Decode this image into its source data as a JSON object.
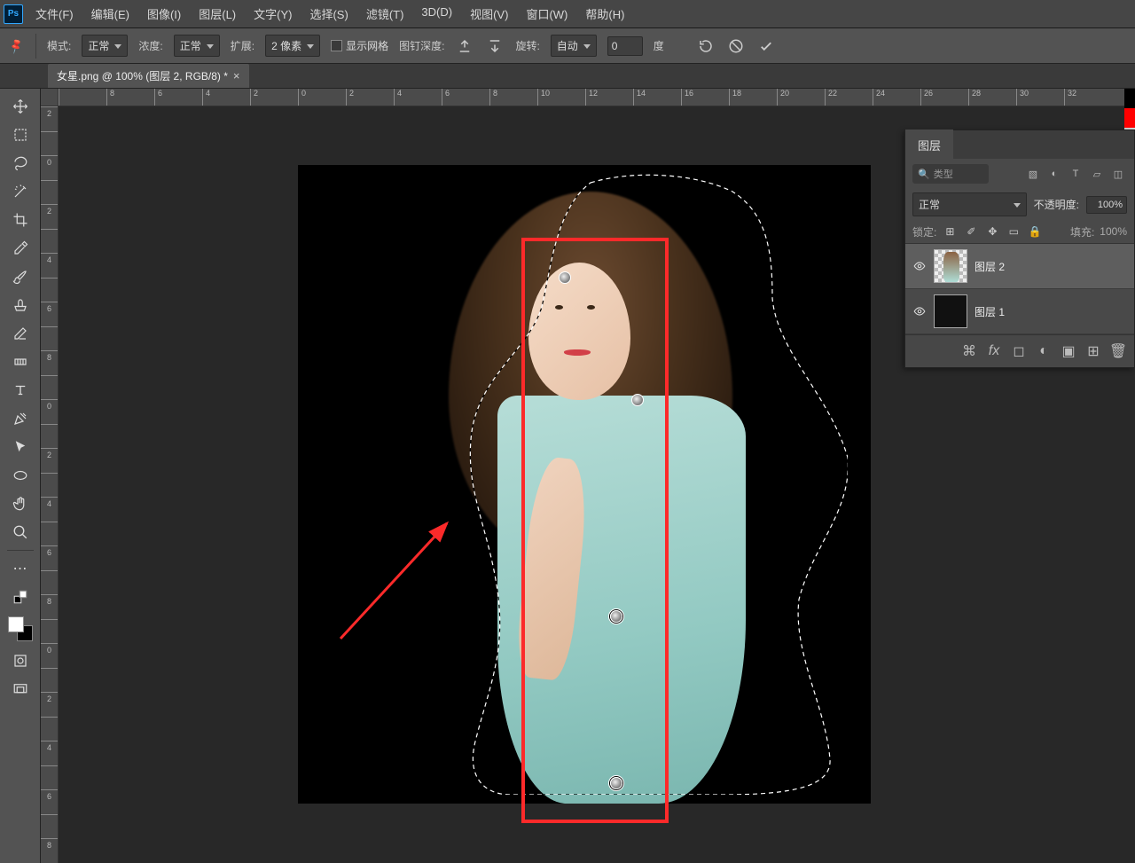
{
  "menu": {
    "items": [
      "文件(F)",
      "编辑(E)",
      "图像(I)",
      "图层(L)",
      "文字(Y)",
      "选择(S)",
      "滤镜(T)",
      "3D(D)",
      "视图(V)",
      "窗口(W)",
      "帮助(H)"
    ]
  },
  "options": {
    "mode_label": "模式:",
    "mode_value": "正常",
    "density_label": "浓度:",
    "density_value": "正常",
    "expand_label": "扩展:",
    "expand_value": "2 像素",
    "show_grid": "显示网格",
    "pin_depth_label": "图钉深度:",
    "rotate_label": "旋转:",
    "rotate_mode": "自动",
    "rotate_value": "0",
    "deg": "度"
  },
  "tab": {
    "title": "女星.png @ 100% (图层 2, RGB/8) *"
  },
  "ruler": {
    "h": [
      "",
      "8",
      "6",
      "4",
      "2",
      "0",
      "2",
      "4",
      "6",
      "8",
      "10",
      "12",
      "14",
      "16",
      "18",
      "20",
      "22",
      "24",
      "26",
      "28",
      "30",
      "32"
    ],
    "v": [
      "2",
      "",
      "0",
      "",
      "2",
      "",
      "4",
      "",
      "6",
      "",
      "8",
      "",
      "0",
      "",
      "2",
      "",
      "4",
      "",
      "6",
      "",
      "8",
      "",
      "0",
      "",
      "2",
      "",
      "4",
      "",
      "6",
      "",
      "8"
    ]
  },
  "panel": {
    "tab": "图层",
    "kind_placeholder": "类型",
    "blend": "正常",
    "opacity_label": "不透明度:",
    "opacity": "100%",
    "lock_label": "锁定:",
    "fill_label": "填充:",
    "fill": "100%",
    "layers": [
      {
        "name": "图层 2",
        "active": true,
        "trans": true
      },
      {
        "name": "图层 1",
        "active": false,
        "trans": false
      }
    ]
  }
}
